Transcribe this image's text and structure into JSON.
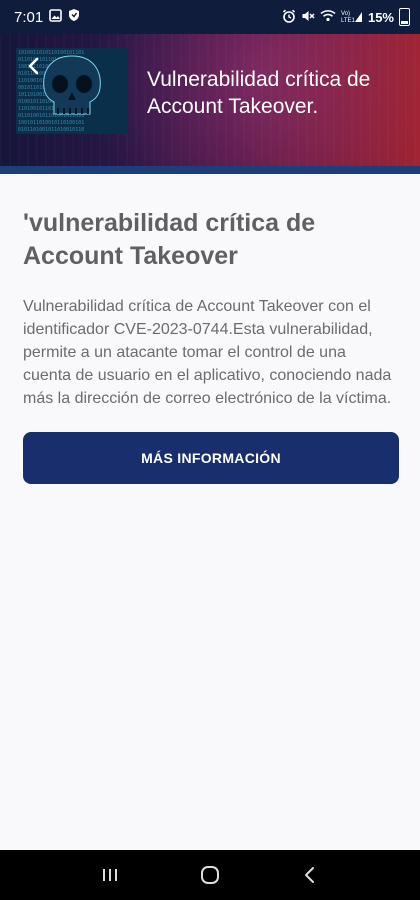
{
  "status_bar": {
    "time": "7:01",
    "battery": "15%",
    "network": "VoLTE"
  },
  "header": {
    "back_icon": "chevron-left-icon",
    "thumbnail": "skull-binary-image",
    "title": "Vulnerabilidad crítica de Account Takeover."
  },
  "article": {
    "title": "'vulnerabilidad crítica de Account Takeover",
    "body": "Vulnerabilidad crítica de Account Takeover con el identificador CVE-2023-0744.Esta vulnerabilidad, permite a un atacante tomar el control de una cuenta de usuario en el aplicativo, conociendo nada más la dirección de correo electrónico de la víctima.",
    "more_button_label": "MÁS INFORMACIÓN"
  },
  "nav_bar": {
    "recents_icon": "recents-icon",
    "home_icon": "home-icon",
    "back_icon": "back-icon"
  },
  "colors": {
    "status_bar": "#0f1c3c",
    "button": "#182e6d",
    "header_accent": "#1c3e7a",
    "title_text": "#5f5f64",
    "body_text": "#6b6b70"
  }
}
